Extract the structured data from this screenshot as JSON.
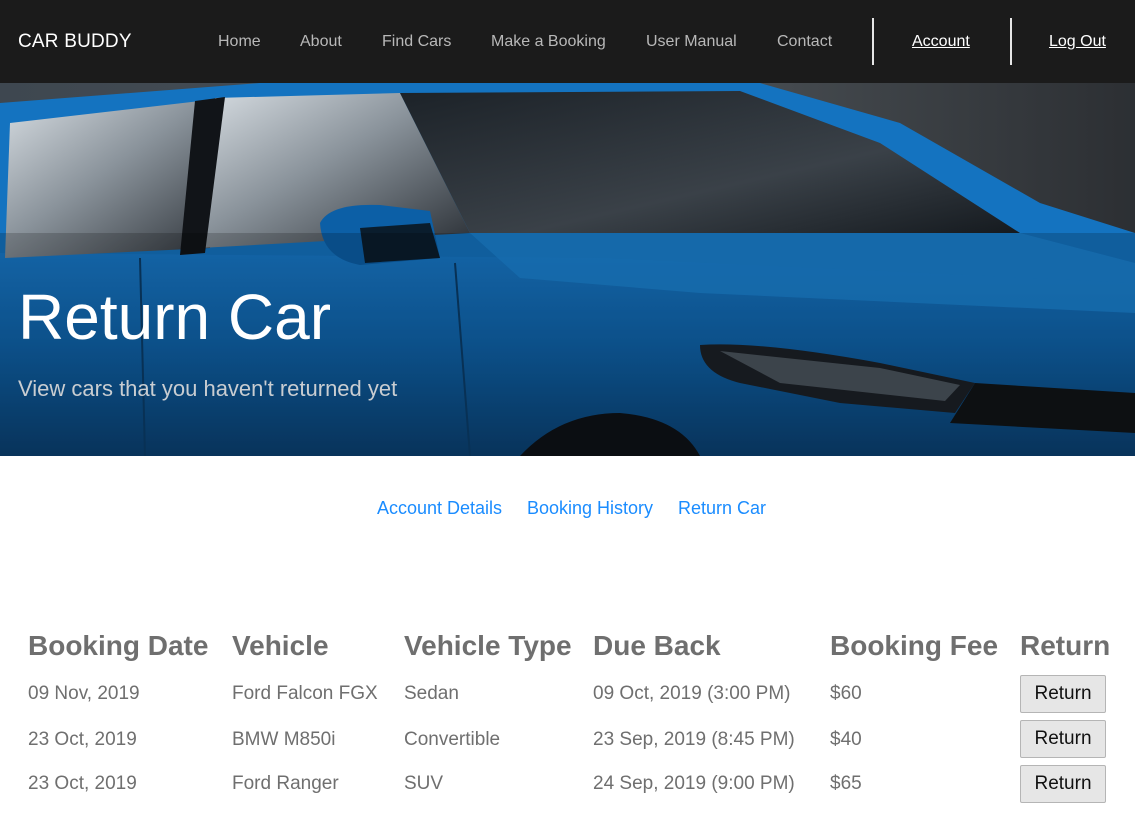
{
  "brand": "CAR BUDDY",
  "nav": {
    "items": [
      "Home",
      "About",
      "Find Cars",
      "Make a Booking",
      "User Manual",
      "Contact"
    ],
    "account": "Account",
    "logout": "Log Out"
  },
  "hero": {
    "title": "Return Car",
    "subtitle": "View cars that you haven't returned yet"
  },
  "subnav": [
    "Account Details",
    "Booking History",
    "Return Car"
  ],
  "table": {
    "headers": [
      "Booking Date",
      "Vehicle",
      "Vehicle Type",
      "Due Back",
      "Booking Fee",
      "Return"
    ],
    "rows": [
      {
        "booking_date": "09 Nov, 2019",
        "vehicle": "Ford Falcon FGX",
        "type": "Sedan",
        "due_back": "09 Oct, 2019 (3:00 PM)",
        "fee": "$60",
        "action": "Return"
      },
      {
        "booking_date": "23 Oct, 2019",
        "vehicle": "BMW M850i",
        "type": "Convertible",
        "due_back": "23 Sep, 2019 (8:45 PM)",
        "fee": "$40",
        "action": "Return"
      },
      {
        "booking_date": "23 Oct, 2019",
        "vehicle": "Ford Ranger",
        "type": "SUV",
        "due_back": "24 Sep, 2019 (9:00 PM)",
        "fee": "$65",
        "action": "Return"
      }
    ]
  },
  "colors": {
    "navbar": "#1b1b1b",
    "link": "#1a8cff",
    "car_body": "#0f62a8",
    "table_text": "#6f6f6f"
  }
}
